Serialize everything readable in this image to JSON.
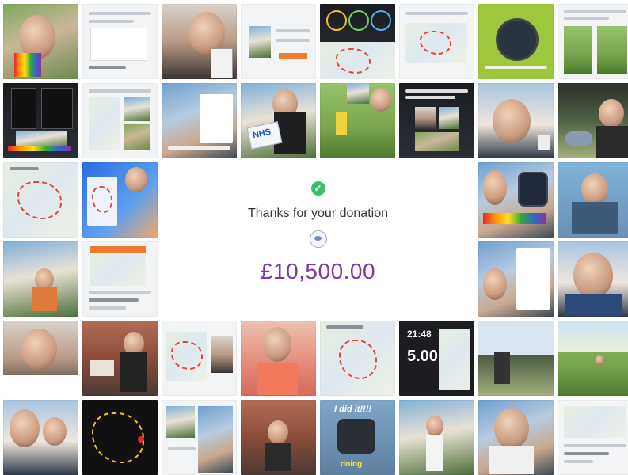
{
  "confirmation": {
    "status_icon": "check-circle-icon",
    "heading": "Thanks for your donation",
    "logo_icon": "charity-logo-icon",
    "amount": "£10,500.00",
    "subtext": "",
    "colors": {
      "check": "#3bbf6a",
      "amount": "#7b3b9e"
    }
  },
  "collage": {
    "tile_count": 48,
    "visible_overlays": {
      "nhs_sign": "NHS",
      "watch_time": "21:48",
      "watch_distance": "5.00",
      "story_caption": "I did it!!!!",
      "story_caption_2": "doing"
    }
  }
}
